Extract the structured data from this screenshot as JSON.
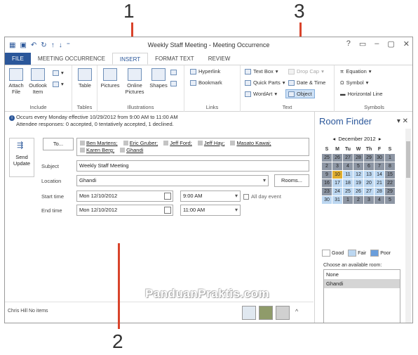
{
  "callouts": [
    "1",
    "2",
    "3"
  ],
  "window": {
    "title": "Weekly Staff Meeting - Meeting Occurrence",
    "help": "?",
    "controls": [
      "▭",
      "–",
      "▢",
      "✕"
    ]
  },
  "tabs": [
    "FILE",
    "MEETING OCCURRENCE",
    "INSERT",
    "FORMAT TEXT",
    "REVIEW"
  ],
  "ribbon": {
    "include": {
      "label": "Include",
      "attach": "Attach File",
      "outlook_item": "Outlook Item"
    },
    "tables": {
      "label": "Tables",
      "table": "Table"
    },
    "illustrations": {
      "label": "Illustrations",
      "pictures": "Pictures",
      "online_pictures": "Online Pictures",
      "shapes": "Shapes"
    },
    "links": {
      "label": "Links",
      "hyperlink": "Hyperlink",
      "bookmark": "Bookmark"
    },
    "text": {
      "label": "Text",
      "text_box": "Text Box",
      "quick_parts": "Quick Parts",
      "wordart": "WordArt",
      "drop_cap": "Drop Cap",
      "date_time": "Date & Time",
      "object": "Object"
    },
    "symbols": {
      "label": "Symbols",
      "equation": "Equation",
      "symbol": "Symbol",
      "horizontal_line": "Horizontal Line"
    }
  },
  "info": {
    "line1": "Occurs every Monday effective 10/29/2012 from 9:00 AM to 11:00 AM",
    "line2": "Attendee responses: 0 accepted, 0 tentatively accepted, 1 declined."
  },
  "form": {
    "send_update": "Send Update",
    "to_button": "To...",
    "attendees": [
      "Ben Martens;",
      "Eric Gruber;",
      "Jeff Ford;",
      "Jeff Hay;",
      "Masato Kawai;",
      "Karen Berg;",
      "Ghandi"
    ],
    "subject_label": "Subject",
    "subject_value": "Weekly Staff Meeting",
    "location_label": "Location",
    "location_value": "Ghandi",
    "rooms_button": "Rooms...",
    "start_label": "Start time",
    "start_date": "Mon 12/10/2012",
    "start_time": "9:00 AM",
    "all_day": "All day event",
    "end_label": "End time",
    "end_date": "Mon 12/10/2012",
    "end_time": "11:00 AM"
  },
  "status": {
    "text": "Chris Hill  No items"
  },
  "watermark": "PanduanPraktis.com",
  "room_finder": {
    "title": "Room Finder",
    "month": "December 2012",
    "weekdays": [
      "S",
      "M",
      "Tu",
      "W",
      "Th",
      "F",
      "S"
    ],
    "days": [
      [
        "25",
        "26",
        "27",
        "28",
        "29",
        "30",
        "1"
      ],
      [
        "2",
        "3",
        "4",
        "5",
        "6",
        "7",
        "8"
      ],
      [
        "9",
        "10",
        "11",
        "12",
        "13",
        "14",
        "15"
      ],
      [
        "16",
        "17",
        "18",
        "19",
        "20",
        "21",
        "22"
      ],
      [
        "23",
        "24",
        "25",
        "26",
        "27",
        "28",
        "29"
      ],
      [
        "30",
        "31",
        "1",
        "2",
        "3",
        "4",
        "5"
      ]
    ],
    "legend": {
      "good": "Good",
      "fair": "Fair",
      "poor": "Poor"
    },
    "choose_label": "Choose an available room:",
    "rooms": [
      "None",
      "Ghandi"
    ],
    "colors": {
      "grey": "#8d96a4",
      "fair": "#bcd7f1",
      "today": "#e0ae2f",
      "poor": "#6a9edc"
    }
  }
}
